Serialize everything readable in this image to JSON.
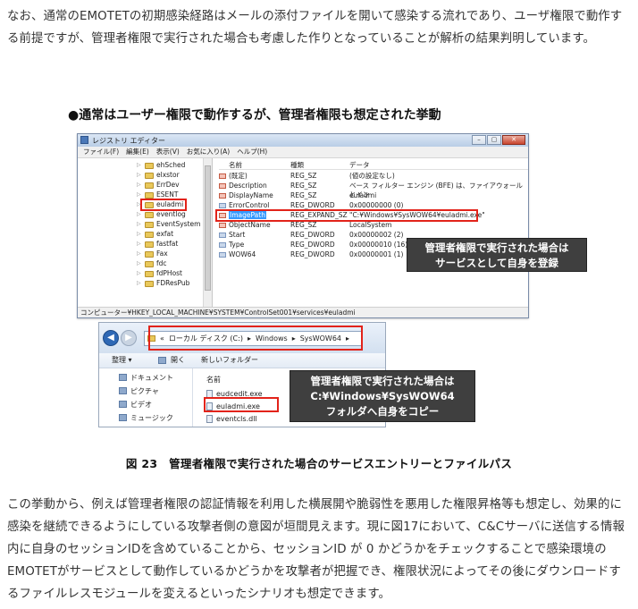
{
  "paragraph1": "なお、通常のEMOTETの初期感染経路はメールの添付ファイルを開いて感染する流れであり、ユーザ権限で動作する前提ですが、管理者権限で実行された場合も考慮した作りとなっていることが解析の結果判明しています。",
  "subheading": "●通常はユーザー権限で動作するが、管理者権限も想定された挙動",
  "regedit": {
    "title": "レジストリ エディター",
    "menu": [
      "ファイル(F)",
      "編集(E)",
      "表示(V)",
      "お気に入り(A)",
      "ヘルプ(H)"
    ],
    "tree": [
      "ehSched",
      "elxstor",
      "ErrDev",
      "ESENT",
      "euladmi",
      "eventlog",
      "EventSystem",
      "exfat",
      "fastfat",
      "Fax",
      "fdc",
      "fdPHost",
      "FDResPub"
    ],
    "headers": {
      "name": "名前",
      "type": "種類",
      "data": "データ"
    },
    "values": [
      {
        "name": "(既定)",
        "type": "REG_SZ",
        "data": "(値の設定なし)"
      },
      {
        "name": "Description",
        "type": "REG_SZ",
        "data": "ベース フィルター エンジン (BFE) は、ファイアウォールとイン"
      },
      {
        "name": "DisplayName",
        "type": "REG_SZ",
        "data": "euladmi"
      },
      {
        "name": "ErrorControl",
        "type": "REG_DWORD",
        "data": "0x00000000 (0)"
      },
      {
        "name": "ImagePath",
        "type": "REG_EXPAND_SZ",
        "data": "\"C:¥Windows¥SysWOW64¥euladmi.exe\""
      },
      {
        "name": "ObjectName",
        "type": "REG_SZ",
        "data": "LocalSystem"
      },
      {
        "name": "Start",
        "type": "REG_DWORD",
        "data": "0x00000002 (2)"
      },
      {
        "name": "Type",
        "type": "REG_DWORD",
        "data": "0x00000010 (16)"
      },
      {
        "name": "WOW64",
        "type": "REG_DWORD",
        "data": "0x00000001 (1)"
      }
    ],
    "status": "コンピューター¥HKEY_LOCAL_MACHINE¥SYSTEM¥ControlSet001¥services¥euladmi",
    "callout_line1": "管理者権限で実行された場合は",
    "callout_line2": "サービスとして自身を登録"
  },
  "explorer": {
    "address_prefix": "«",
    "address_part1": "ローカル ディスク (C:)",
    "address_part2": "Windows",
    "address_part3": "SysWOW64",
    "sep": "▸",
    "toolbar_organize": "整理 ▾",
    "toolbar_open": "開く",
    "toolbar_newfolder": "新しいフォルダー",
    "nav": [
      "ドキュメント",
      "ピクチャ",
      "ビデオ",
      "ミュージック"
    ],
    "name_header": "名前",
    "files": [
      "eudcedit.exe",
      "euladmi.exe",
      "eventcls.dll"
    ],
    "callout_line1": "管理者権限で実行された場合は",
    "callout_line2": "C:¥Windows¥SysWOW64",
    "callout_line3": "フォルダへ自身をコピー"
  },
  "caption": "図 23　管理者権限で実行された場合のサービスエントリーとファイルパス",
  "paragraph2": "この挙動から、例えば管理者権限の認証情報を利用した横展開や脆弱性を悪用した権限昇格等も想定し、効果的に感染を継続できるようにしている攻撃者側の意図が垣間見えます。現に図17において、C&Cサーバに送信する情報内に自身のセッションIDを含めていることから、セッションID が 0 かどうかをチェックすることで感染環境のEMOTETがサービスとして動作しているかどうかを攻撃者が把握でき、権限状況によってその後にダウンロードするファイルレスモジュールを変えるといったシナリオも想定できます。"
}
